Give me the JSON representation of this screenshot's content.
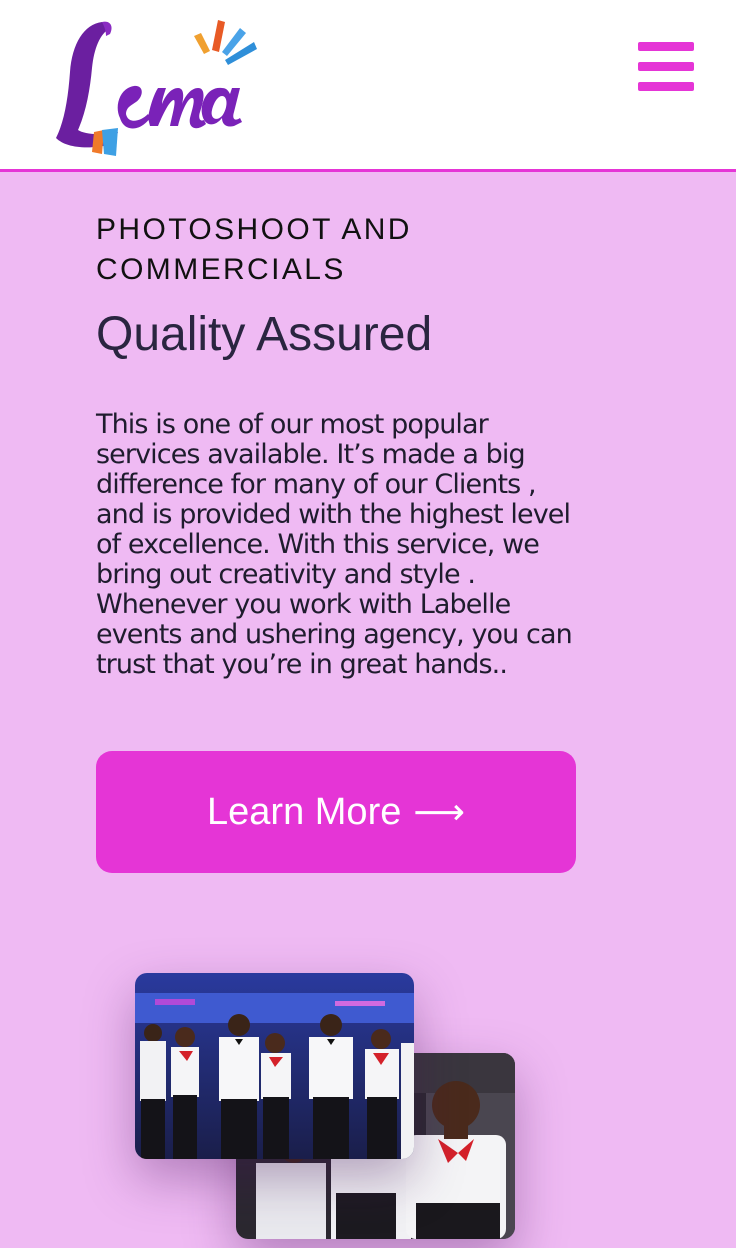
{
  "header": {
    "logo_text": "Lema",
    "menu_icon": "hamburger-menu-icon"
  },
  "hero": {
    "eyebrow": "PHOTOSHOOT AND COMMERCIALS",
    "headline": "Quality Assured",
    "body": "This is one of our most popular services available. It’s made a big difference for many of our Clients , and is provided with the highest level of excellence. With this service, we bring out creativity and style . Whenever you work with Labelle events and ushering agency, you can trust that you’re in great hands..",
    "cta_label": "Learn More",
    "cta_arrow": "⟶"
  },
  "gallery": {
    "images": [
      "group-photo-ushers",
      "portrait-usher"
    ]
  },
  "colors": {
    "accent": "#e535d6",
    "background": "#efbaf3",
    "header_bg": "#ffffff",
    "text_dark": "#1f1c2e"
  }
}
